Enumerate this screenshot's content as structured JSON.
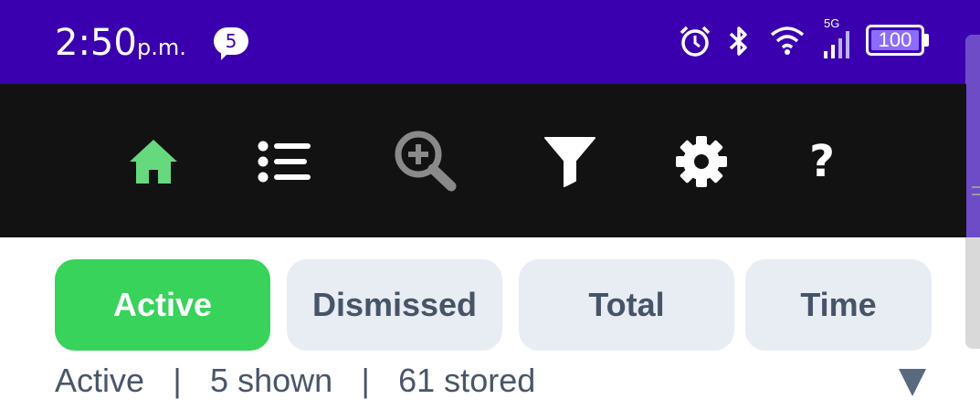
{
  "status_bar": {
    "time": "2:50",
    "ampm": "p.m.",
    "notification_count": "5",
    "network": "5G",
    "battery": "100",
    "background": "#3a00b0"
  },
  "toolbar": {
    "items": [
      {
        "icon": "home-icon",
        "color": "#66d97f",
        "active": true
      },
      {
        "icon": "list-icon",
        "color": "#ffffff"
      },
      {
        "icon": "zoom-in-icon",
        "color": "#8a8a8a"
      },
      {
        "icon": "filter-icon",
        "color": "#ffffff"
      },
      {
        "icon": "gear-icon",
        "color": "#ffffff"
      },
      {
        "icon": "help-icon",
        "color": "#ffffff",
        "glyph": "?"
      }
    ]
  },
  "tabs": [
    {
      "label": "Active",
      "selected": true
    },
    {
      "label": "Dismissed",
      "selected": false
    },
    {
      "label": "Total",
      "selected": false
    },
    {
      "label": "Time",
      "selected": false
    }
  ],
  "summary": {
    "mode": "Active",
    "separator": "|",
    "shown": "5 shown",
    "stored": "61 stored"
  },
  "colors": {
    "accent_green": "#37d35a",
    "tab_inactive_bg": "#e8ecf3",
    "tab_inactive_text": "#475467",
    "toolbar_bg": "#121212"
  }
}
